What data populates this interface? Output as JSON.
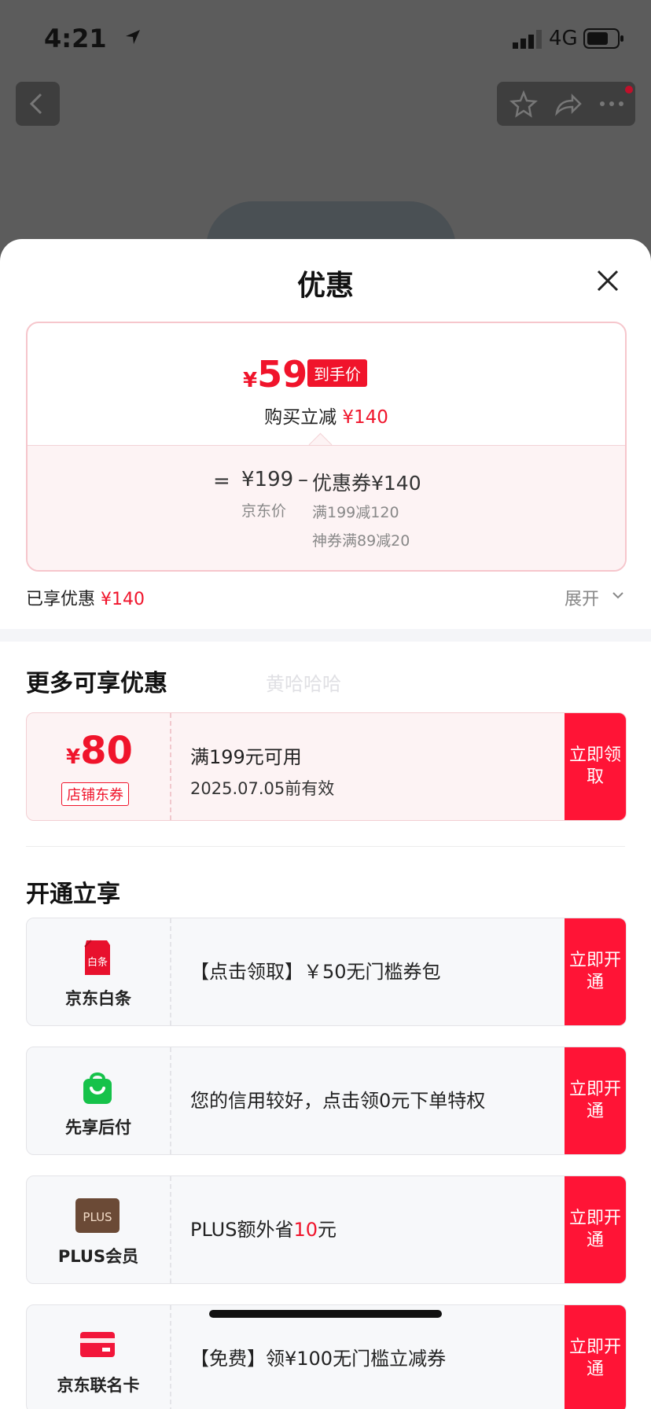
{
  "status": {
    "time": "4:21",
    "network": "4G"
  },
  "sheet": {
    "title": "优惠"
  },
  "price_card": {
    "currency": "¥",
    "final_price": "59",
    "final_tag": "到手价",
    "reduce_label": "购买立减",
    "reduce_amount": "¥140",
    "eq": "=",
    "jd_price": "¥199",
    "minus": "–",
    "coupon_total": "优惠券¥140",
    "jd_price_label": "京东价",
    "detail_1": "满199减120",
    "detail_2": "神券满89减20"
  },
  "enjoyed": {
    "label": "已享优惠",
    "amount": "¥140",
    "expand": "展开"
  },
  "more": {
    "title": "更多可享优惠",
    "watermark": "黄哈哈哈",
    "coupon": {
      "currency": "¥",
      "amount": "80",
      "tag": "店铺东券",
      "condition": "满199元可用",
      "valid": "2025.07.05前有效",
      "button": "立即领取"
    }
  },
  "open": {
    "title": "开通立享",
    "items": [
      {
        "name": "京东白条",
        "icon": "baitiao-icon",
        "icon_text": "白条",
        "text": "【点击领取】￥50无门槛券包",
        "button": "立即开通"
      },
      {
        "name": "先享后付",
        "icon": "shopping-bag-icon",
        "text": "您的信用较好，点击领0元下单特权",
        "button": "立即开通"
      },
      {
        "name": "PLUS会员",
        "icon": "plus-icon",
        "icon_text": "PLUS",
        "text_pre": "PLUS额外省",
        "text_red": "10",
        "text_post": "元",
        "button": "立即开通"
      },
      {
        "name": "京东联名卡",
        "icon": "card-icon",
        "text": "【免费】领¥100无门槛立减券",
        "button": "立即开通"
      }
    ]
  },
  "colors": {
    "accent": "#f0142b",
    "button_red": "#ff1436",
    "overlay": "#5c5c5c"
  }
}
